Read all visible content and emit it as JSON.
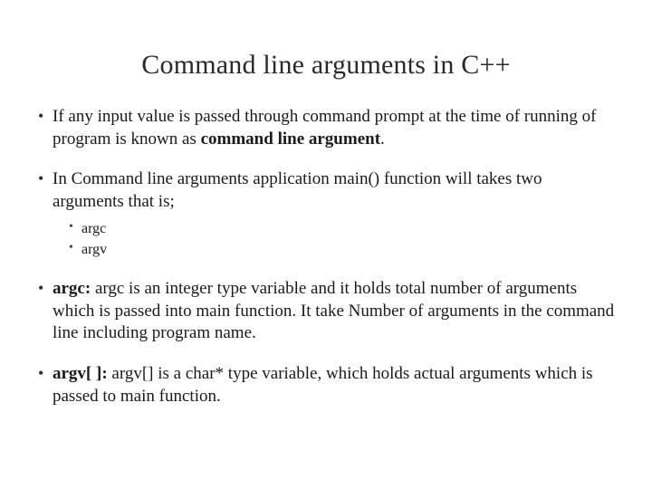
{
  "title": "Command line arguments in C++",
  "bullets": [
    {
      "pre": "If any input value is passed through command prompt at the time of running of program is known as ",
      "bold": "command line argument",
      "post": "."
    },
    {
      "pre": "In Command line arguments application main() function will takes two arguments that is;",
      "bold": "",
      "post": "",
      "sub": [
        "argc",
        "argv"
      ]
    },
    {
      "boldLead": "argc:",
      "post": " argc is an integer type variable and it holds total number of arguments which is passed into main function. It take Number of arguments in the command line including program name."
    },
    {
      "boldLead": "argv[ ]:",
      "post": " argv[] is a char* type variable, which holds actual arguments which is passed to main function."
    }
  ]
}
